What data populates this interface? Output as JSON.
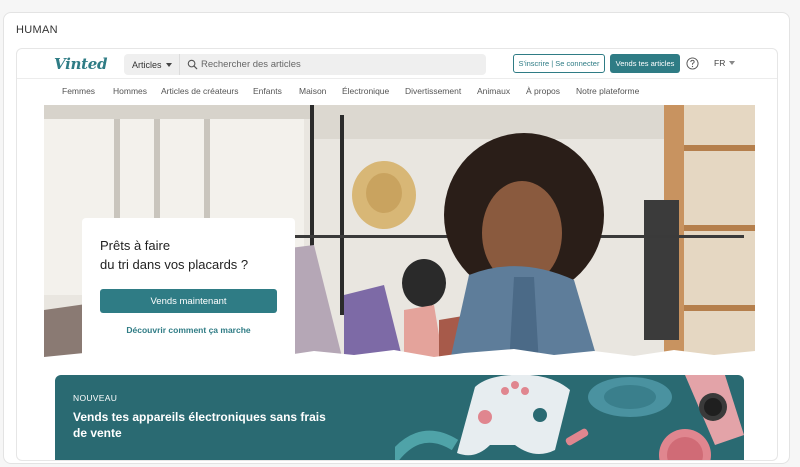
{
  "outer_label": "HUMAN",
  "header": {
    "logo": "Vinted",
    "category_select": "Articles",
    "search_placeholder": "Rechercher des articles",
    "signup_button": "S'inscrire | Se connecter",
    "sell_button": "Vends tes articles",
    "help_icon": "question-circle-icon",
    "language": "FR"
  },
  "nav": {
    "items": [
      "Femmes",
      "Hommes",
      "Articles de créateurs",
      "Enfants",
      "Maison",
      "Électronique",
      "Divertissement",
      "Animaux",
      "À propos",
      "Notre plateforme"
    ]
  },
  "hero": {
    "title_line1": "Prêts à faire",
    "title_line2": "du tri dans vos placards ?",
    "cta_button": "Vends maintenant",
    "cta_link": "Découvrir comment ça marche"
  },
  "promo": {
    "tag": "NOUVEAU",
    "title": "Vends tes appareils électroniques sans frais de vente"
  },
  "colors": {
    "brand": "#2f7c85",
    "promo_bg": "#2a6a72"
  }
}
